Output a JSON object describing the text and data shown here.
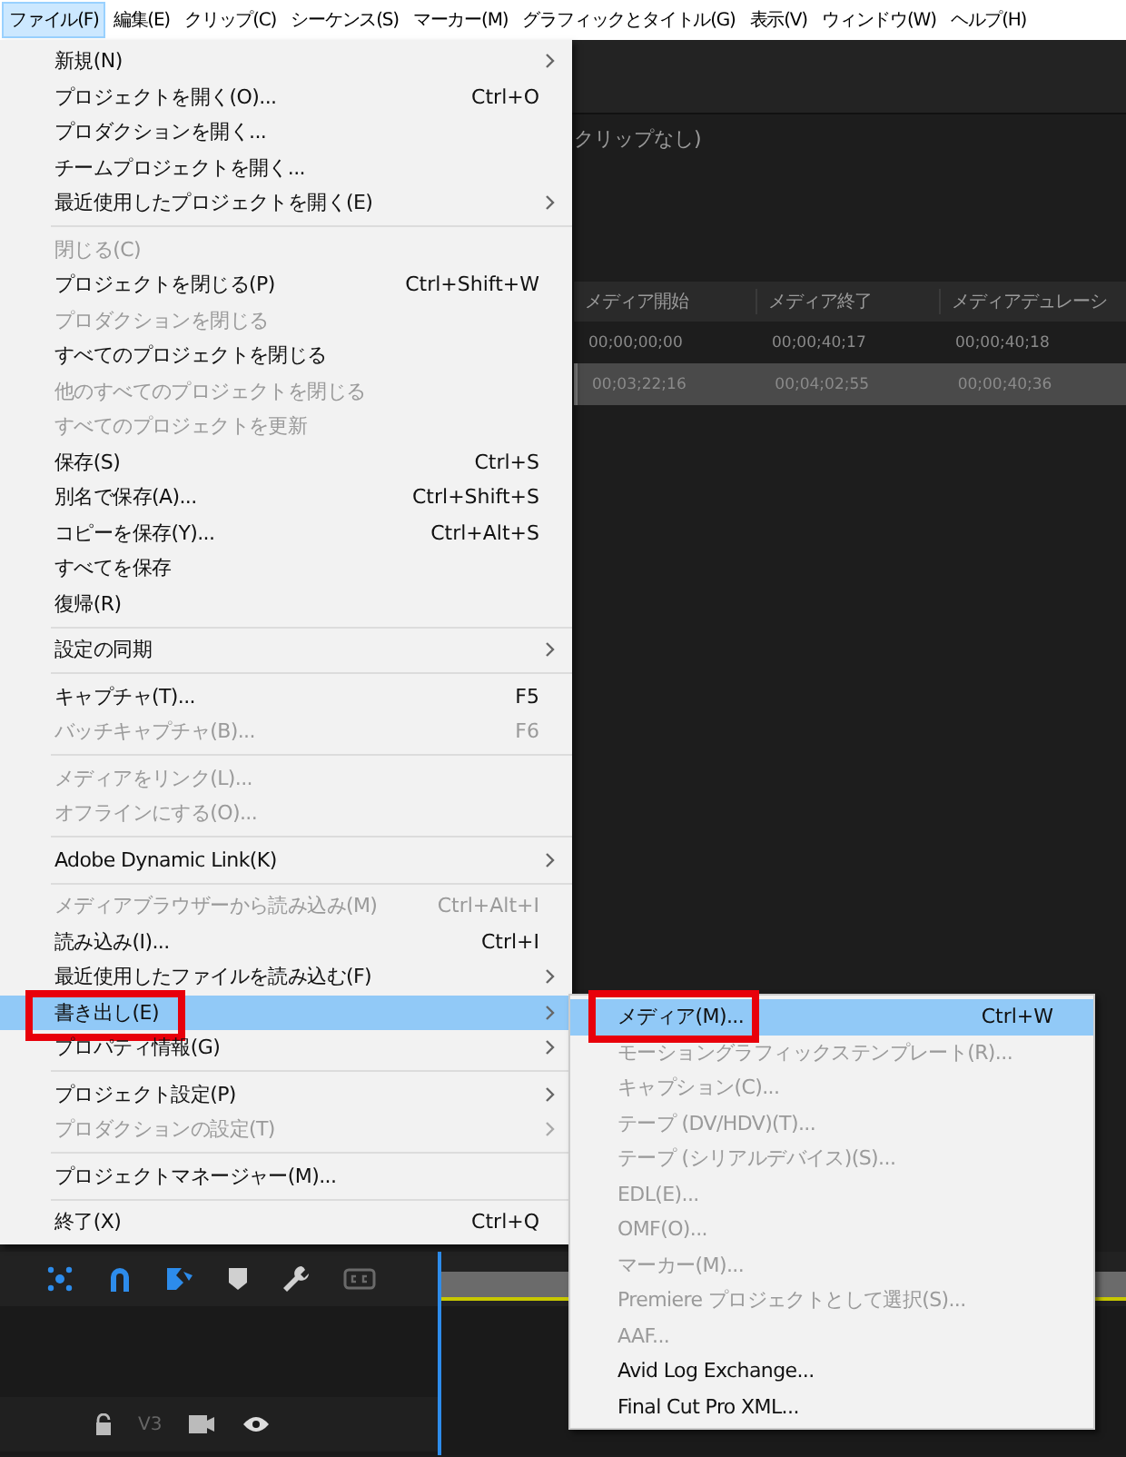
{
  "menubar": [
    {
      "label": "ファイル(F)",
      "selected": true
    },
    {
      "label": "編集(E)",
      "selected": false
    },
    {
      "label": "クリップ(C)",
      "selected": false
    },
    {
      "label": "シーケンス(S)",
      "selected": false
    },
    {
      "label": "マーカー(M)",
      "selected": false
    },
    {
      "label": "グラフィックとタイトル(G)",
      "selected": false
    },
    {
      "label": "表示(V)",
      "selected": false
    },
    {
      "label": "ウィンドウ(W)",
      "selected": false
    },
    {
      "label": "ヘルプ(H)",
      "selected": false
    }
  ],
  "monitor": {
    "text": "クリップなし)"
  },
  "table": {
    "columns": [
      "メディア開始",
      "メディア終了",
      "メディアデュレーシ"
    ],
    "rows": [
      {
        "cells": [
          "00;00;00;00",
          "00;00;40;17",
          "00;00;40;18"
        ],
        "selected": false
      },
      {
        "cells": [
          "00;03;22;16",
          "00;04;02;55",
          "00;00;40;36"
        ],
        "selected": true
      }
    ]
  },
  "timeline": {
    "track_label": "V3"
  },
  "file_menu": {
    "items": [
      {
        "kind": "item",
        "label": "新規(N)",
        "submenu": true,
        "disabled": false,
        "selected": false,
        "highlighted": false
      },
      {
        "kind": "item",
        "label": "プロジェクトを開く(O)...",
        "shortcut": "Ctrl+O",
        "submenu": false,
        "disabled": false,
        "selected": false,
        "highlighted": false
      },
      {
        "kind": "item",
        "label": "プロダクションを開く...",
        "submenu": false,
        "disabled": false,
        "selected": false,
        "highlighted": false
      },
      {
        "kind": "item",
        "label": "チームプロジェクトを開く...",
        "submenu": false,
        "disabled": false,
        "selected": false,
        "highlighted": false
      },
      {
        "kind": "item",
        "label": "最近使用したプロジェクトを開く(E)",
        "submenu": true,
        "disabled": false,
        "selected": false,
        "highlighted": false
      },
      {
        "kind": "separator"
      },
      {
        "kind": "item",
        "label": "閉じる(C)",
        "submenu": false,
        "disabled": true,
        "selected": false,
        "highlighted": false
      },
      {
        "kind": "item",
        "label": "プロジェクトを閉じる(P)",
        "shortcut": "Ctrl+Shift+W",
        "submenu": false,
        "disabled": false,
        "selected": false,
        "highlighted": false
      },
      {
        "kind": "item",
        "label": "プロダクションを閉じる",
        "submenu": false,
        "disabled": true,
        "selected": false,
        "highlighted": false
      },
      {
        "kind": "item",
        "label": "すべてのプロジェクトを閉じる",
        "submenu": false,
        "disabled": false,
        "selected": false,
        "highlighted": false
      },
      {
        "kind": "item",
        "label": "他のすべてのプロジェクトを閉じる",
        "submenu": false,
        "disabled": true,
        "selected": false,
        "highlighted": false
      },
      {
        "kind": "item",
        "label": "すべてのプロジェクトを更新",
        "submenu": false,
        "disabled": true,
        "selected": false,
        "highlighted": false
      },
      {
        "kind": "item",
        "label": "保存(S)",
        "shortcut": "Ctrl+S",
        "submenu": false,
        "disabled": false,
        "selected": false,
        "highlighted": false
      },
      {
        "kind": "item",
        "label": "別名で保存(A)...",
        "shortcut": "Ctrl+Shift+S",
        "submenu": false,
        "disabled": false,
        "selected": false,
        "highlighted": false
      },
      {
        "kind": "item",
        "label": "コピーを保存(Y)...",
        "shortcut": "Ctrl+Alt+S",
        "submenu": false,
        "disabled": false,
        "selected": false,
        "highlighted": false
      },
      {
        "kind": "item",
        "label": "すべてを保存",
        "submenu": false,
        "disabled": false,
        "selected": false,
        "highlighted": false
      },
      {
        "kind": "item",
        "label": "復帰(R)",
        "submenu": false,
        "disabled": false,
        "selected": false,
        "highlighted": false
      },
      {
        "kind": "separator"
      },
      {
        "kind": "item",
        "label": "設定の同期",
        "submenu": true,
        "disabled": false,
        "selected": false,
        "highlighted": false
      },
      {
        "kind": "separator"
      },
      {
        "kind": "item",
        "label": "キャプチャ(T)...",
        "shortcut": "F5",
        "submenu": false,
        "disabled": false,
        "selected": false,
        "highlighted": false
      },
      {
        "kind": "item",
        "label": "バッチキャプチャ(B)...",
        "shortcut": "F6",
        "submenu": false,
        "disabled": true,
        "selected": false,
        "highlighted": false
      },
      {
        "kind": "separator"
      },
      {
        "kind": "item",
        "label": "メディアをリンク(L)...",
        "submenu": false,
        "disabled": true,
        "selected": false,
        "highlighted": false
      },
      {
        "kind": "item",
        "label": "オフラインにする(O)...",
        "submenu": false,
        "disabled": true,
        "selected": false,
        "highlighted": false
      },
      {
        "kind": "separator"
      },
      {
        "kind": "item",
        "label": "Adobe Dynamic Link(K)",
        "submenu": true,
        "disabled": false,
        "selected": false,
        "highlighted": false
      },
      {
        "kind": "separator"
      },
      {
        "kind": "item",
        "label": "メディアブラウザーから読み込み(M)",
        "shortcut": "Ctrl+Alt+I",
        "submenu": false,
        "disabled": true,
        "selected": false,
        "highlighted": false
      },
      {
        "kind": "item",
        "label": "読み込み(I)...",
        "shortcut": "Ctrl+I",
        "submenu": false,
        "disabled": false,
        "selected": false,
        "highlighted": false
      },
      {
        "kind": "item",
        "label": "最近使用したファイルを読み込む(F)",
        "submenu": true,
        "disabled": false,
        "selected": false,
        "highlighted": false
      },
      {
        "kind": "item",
        "label": "書き出し(E)",
        "submenu": true,
        "disabled": false,
        "selected": true,
        "highlighted": true
      },
      {
        "kind": "item",
        "label": "プロパティ情報(G)",
        "submenu": true,
        "disabled": false,
        "selected": false,
        "highlighted": false
      },
      {
        "kind": "separator"
      },
      {
        "kind": "item",
        "label": "プロジェクト設定(P)",
        "submenu": true,
        "disabled": false,
        "selected": false,
        "highlighted": false
      },
      {
        "kind": "item",
        "label": "プロダクションの設定(T)",
        "submenu": true,
        "disabled": true,
        "selected": false,
        "highlighted": false
      },
      {
        "kind": "separator"
      },
      {
        "kind": "item",
        "label": "プロジェクトマネージャー(M)...",
        "submenu": false,
        "disabled": false,
        "selected": false,
        "highlighted": false
      },
      {
        "kind": "separator"
      },
      {
        "kind": "item",
        "label": "終了(X)",
        "shortcut": "Ctrl+Q",
        "submenu": false,
        "disabled": false,
        "selected": false,
        "highlighted": false
      }
    ]
  },
  "export_menu": {
    "items": [
      {
        "kind": "item",
        "label": "メディア(M)...",
        "shortcut": "Ctrl+W",
        "submenu": false,
        "disabled": false,
        "selected": true,
        "highlighted": true
      },
      {
        "kind": "item",
        "label": "モーショングラフィックステンプレート(R)...",
        "submenu": false,
        "disabled": true,
        "selected": false,
        "highlighted": false
      },
      {
        "kind": "item",
        "label": "キャプション(C)...",
        "submenu": false,
        "disabled": true,
        "selected": false,
        "highlighted": false
      },
      {
        "kind": "item",
        "label": "テープ (DV/HDV)(T)...",
        "submenu": false,
        "disabled": true,
        "selected": false,
        "highlighted": false
      },
      {
        "kind": "item",
        "label": "テープ (シリアルデバイス)(S)...",
        "submenu": false,
        "disabled": true,
        "selected": false,
        "highlighted": false
      },
      {
        "kind": "item",
        "label": "EDL(E)...",
        "submenu": false,
        "disabled": true,
        "selected": false,
        "highlighted": false
      },
      {
        "kind": "item",
        "label": "OMF(O)...",
        "submenu": false,
        "disabled": true,
        "selected": false,
        "highlighted": false
      },
      {
        "kind": "item",
        "label": "マーカー(M)...",
        "submenu": false,
        "disabled": true,
        "selected": false,
        "highlighted": false
      },
      {
        "kind": "item",
        "label": "Premiere プロジェクトとして選択(S)...",
        "submenu": false,
        "disabled": true,
        "selected": false,
        "highlighted": false
      },
      {
        "kind": "item",
        "label": "AAF...",
        "submenu": false,
        "disabled": true,
        "selected": false,
        "highlighted": false
      },
      {
        "kind": "item",
        "label": "Avid Log Exchange...",
        "submenu": false,
        "disabled": false,
        "selected": false,
        "highlighted": false
      },
      {
        "kind": "item",
        "label": "Final Cut Pro XML...",
        "submenu": false,
        "disabled": false,
        "selected": false,
        "highlighted": false
      }
    ]
  }
}
